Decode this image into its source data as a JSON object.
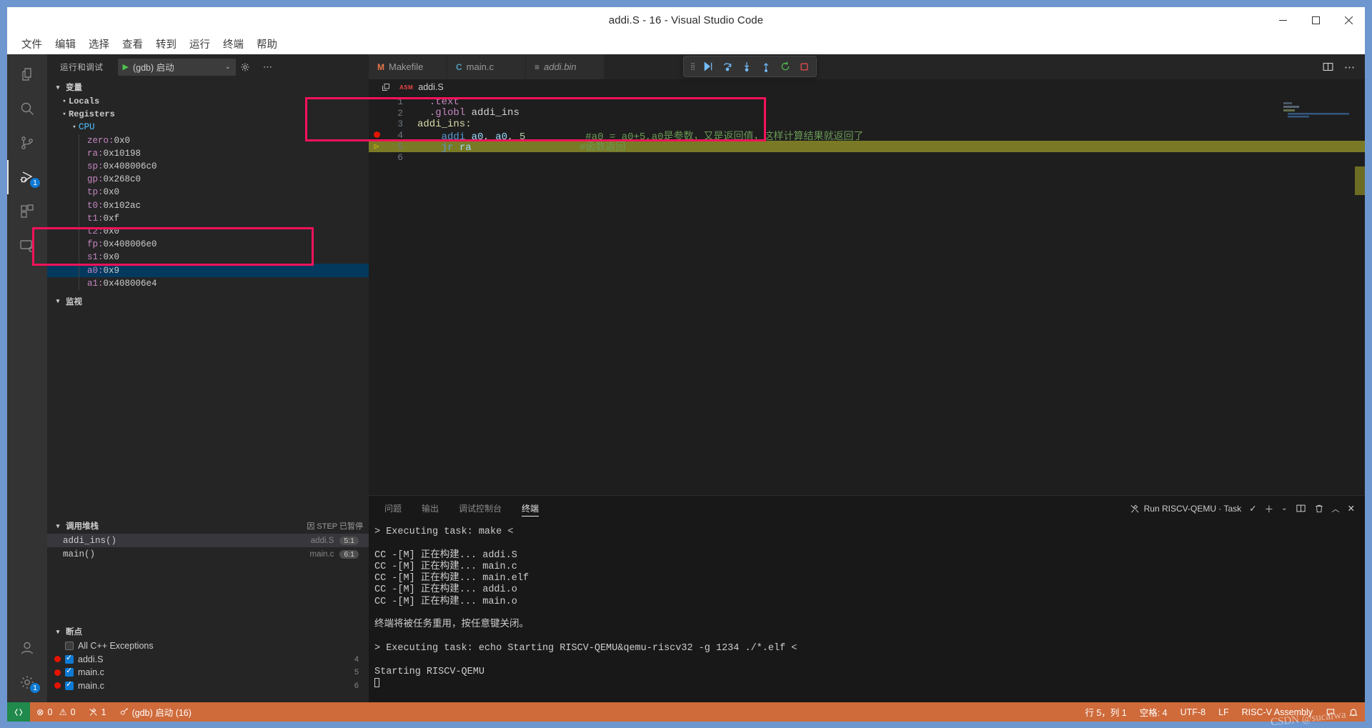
{
  "window": {
    "title": "addi.S - 16 - Visual Studio Code",
    "minimize": "–",
    "maximize": "▢",
    "close": "✕"
  },
  "menubar": {
    "items": [
      {
        "label": "文件"
      },
      {
        "label": "编辑"
      },
      {
        "label": "选择"
      },
      {
        "label": "查看"
      },
      {
        "label": "转到"
      },
      {
        "label": "运行"
      },
      {
        "label": "终端"
      },
      {
        "label": "帮助"
      }
    ]
  },
  "activitybar": {
    "items": [
      {
        "name": "explorer",
        "icon": "files-icon"
      },
      {
        "name": "search",
        "icon": "search-icon"
      },
      {
        "name": "source-control",
        "icon": "source-control-icon"
      },
      {
        "name": "run-and-debug",
        "icon": "run-debug-icon",
        "badge": "1",
        "active": true
      },
      {
        "name": "extensions",
        "icon": "extensions-icon"
      },
      {
        "name": "remote-explorer",
        "icon": "remote-explorer-icon"
      }
    ],
    "bottom": [
      {
        "name": "accounts",
        "icon": "account-icon"
      },
      {
        "name": "settings",
        "icon": "gear-icon",
        "badge": "1"
      }
    ]
  },
  "sidebar": {
    "title": "运行和调试",
    "launch_config": "(gdb) 启动",
    "gear_icon": "gear-icon",
    "more_icon": "ellipsis-icon",
    "variables": {
      "header": "变量",
      "groups": [
        {
          "label": "Locals",
          "indent": 1,
          "twisty": "▾",
          "kind": "group"
        },
        {
          "label": "Registers",
          "indent": 1,
          "twisty": "▾",
          "kind": "group"
        },
        {
          "label": "CPU",
          "indent": 2,
          "twisty": "▾",
          "kind": "cpu"
        }
      ],
      "registers": [
        {
          "name": "zero",
          "value": "0x0",
          "selected": false
        },
        {
          "name": "ra",
          "value": "0x10198",
          "selected": false
        },
        {
          "name": "sp",
          "value": "0x408006c0",
          "selected": false
        },
        {
          "name": "gp",
          "value": "0x268c0",
          "selected": false
        },
        {
          "name": "tp",
          "value": "0x0",
          "selected": false
        },
        {
          "name": "t0",
          "value": "0x102ac",
          "selected": false
        },
        {
          "name": "t1",
          "value": "0xf",
          "selected": false
        },
        {
          "name": "t2",
          "value": "0x0",
          "selected": false
        },
        {
          "name": "fp",
          "value": "0x408006e0",
          "selected": false
        },
        {
          "name": "s1",
          "value": "0x0",
          "selected": false
        },
        {
          "name": "a0",
          "value": "0x9",
          "selected": true
        },
        {
          "name": "a1",
          "value": "0x408006e4",
          "selected": false
        }
      ]
    },
    "watch": {
      "header": "监视"
    },
    "callstack": {
      "header": "调用堆栈",
      "hint": "因 STEP 已暂停",
      "frames": [
        {
          "fn": "addi_ins()",
          "file": "addi.S",
          "pos": "5:1",
          "selected": true
        },
        {
          "fn": "main()",
          "file": "main.c",
          "pos": "6:1",
          "selected": false
        }
      ]
    },
    "breakpoints": {
      "header": "断点",
      "items": [
        {
          "label": "All C++ Exceptions",
          "checked": false,
          "dot": false,
          "num": ""
        },
        {
          "label": "addi.S",
          "checked": true,
          "dot": true,
          "num": "4"
        },
        {
          "label": "main.c",
          "checked": true,
          "dot": true,
          "num": "5"
        },
        {
          "label": "main.c",
          "checked": true,
          "dot": true,
          "num": "6"
        }
      ]
    }
  },
  "editor": {
    "tabs": [
      {
        "label": "Makefile",
        "icon": "M",
        "icon_color": "#e8774b",
        "italic": false,
        "active": false
      },
      {
        "label": "main.c",
        "icon": "C",
        "icon_color": "#519aba",
        "italic": false,
        "active": false
      },
      {
        "label": "addi.bin",
        "icon": "≡",
        "icon_color": "#cccccc",
        "italic": true,
        "active": false
      }
    ],
    "actions": [
      {
        "name": "split-editor-icon",
        "glyph": "▯▯"
      },
      {
        "name": "editor-more-icon",
        "glyph": "⋯"
      }
    ],
    "breadcrumb": {
      "badge": "ASM",
      "label": "addi.S",
      "fold_icon": "collapse-all-icon"
    },
    "debug_toolbar": [
      {
        "name": "grip-handle",
        "glyph": "⋮⋮"
      },
      {
        "name": "continue-button",
        "glyph": "▶|"
      },
      {
        "name": "step-over-button",
        "glyph": "↷"
      },
      {
        "name": "step-into-button",
        "glyph": "↓"
      },
      {
        "name": "step-out-button",
        "glyph": "↑"
      },
      {
        "name": "restart-button",
        "glyph": "↺"
      },
      {
        "name": "stop-button",
        "glyph": "□"
      }
    ],
    "lines": [
      {
        "n": "1",
        "mark": "",
        "tokens": [
          {
            "t": "  ",
            "c": "plain"
          },
          {
            "t": ".text",
            "c": "dir"
          }
        ],
        "hl": false
      },
      {
        "n": "2",
        "mark": "",
        "tokens": [
          {
            "t": "  ",
            "c": "plain"
          },
          {
            "t": ".globl",
            "c": "dir"
          },
          {
            "t": " addi_ins",
            "c": "plain"
          }
        ],
        "hl": false
      },
      {
        "n": "3",
        "mark": "",
        "tokens": [
          {
            "t": "addi_ins:",
            "c": "lbl"
          }
        ],
        "hl": false
      },
      {
        "n": "4",
        "mark": "breakpoint",
        "tokens": [
          {
            "t": "    ",
            "c": "plain"
          },
          {
            "t": "addi",
            "c": "ins"
          },
          {
            "t": " ",
            "c": "plain"
          },
          {
            "t": "a0",
            "c": "reg"
          },
          {
            "t": ", ",
            "c": "plain"
          },
          {
            "t": "a0",
            "c": "reg"
          },
          {
            "t": ", ",
            "c": "plain"
          },
          {
            "t": "5",
            "c": "num"
          },
          {
            "t": "          ",
            "c": "plain"
          },
          {
            "t": "#a0 = a0+5,a0是参数，又是返回值，这样计算结果就返回了",
            "c": "cmt"
          }
        ],
        "hl": false
      },
      {
        "n": "5",
        "mark": "current",
        "tokens": [
          {
            "t": "    ",
            "c": "plain"
          },
          {
            "t": "jr",
            "c": "ins"
          },
          {
            "t": " ",
            "c": "plain"
          },
          {
            "t": "ra",
            "c": "reg"
          },
          {
            "t": "                  ",
            "c": "plain"
          },
          {
            "t": "#函数返回",
            "c": "cmt"
          }
        ],
        "hl": true
      },
      {
        "n": "6",
        "mark": "",
        "tokens": [],
        "hl": false
      }
    ]
  },
  "panel": {
    "tabs": [
      {
        "label": "问题",
        "active": false
      },
      {
        "label": "输出",
        "active": false
      },
      {
        "label": "调试控制台",
        "active": false
      },
      {
        "label": "终端",
        "active": true
      }
    ],
    "terminal_name": "Run RISCV-QEMU · Task",
    "terminal_icon": "tools-icon",
    "actions": [
      {
        "name": "task-check-icon",
        "glyph": "✓"
      },
      {
        "name": "new-terminal-icon",
        "glyph": "＋"
      },
      {
        "name": "terminal-dropdown-icon",
        "glyph": "⌄"
      },
      {
        "name": "split-terminal-icon",
        "glyph": "▯▯"
      },
      {
        "name": "kill-terminal-icon",
        "glyph": "🗑"
      },
      {
        "name": "maximize-panel-icon",
        "glyph": "︿"
      },
      {
        "name": "close-panel-icon",
        "glyph": "✕"
      }
    ],
    "terminal_lines": [
      "> Executing task: make <",
      "",
      "CC -[M] 正在构建... addi.S",
      "CC -[M] 正在构建... main.c",
      "CC -[M] 正在构建... main.elf",
      "CC -[M] 正在构建... addi.o",
      "CC -[M] 正在构建... main.o",
      "",
      "终端将被任务重用，按任意键关闭。",
      "",
      "> Executing task: echo Starting RISCV-QEMU&qemu-riscv32 -g 1234 ./*.elf <",
      "",
      "Starting RISCV-QEMU"
    ]
  },
  "statusbar": {
    "remote_icon": "remote-icon",
    "left": [
      {
        "name": "problems",
        "glyph": "⊗",
        "text": "0",
        "glyph2": "△",
        "text2": "0"
      },
      {
        "name": "tasks",
        "glyph": "🛠",
        "text": "1"
      },
      {
        "name": "debug-session",
        "glyph": "⚲",
        "text": "(gdb) 启动 (16)"
      }
    ],
    "right": [
      {
        "name": "cursor-position",
        "text": "行 5，列 1"
      },
      {
        "name": "indentation",
        "text": "空格: 4"
      },
      {
        "name": "encoding",
        "text": "UTF-8"
      },
      {
        "name": "eol",
        "text": "LF"
      },
      {
        "name": "language-mode",
        "text": "RISC-V Assembly"
      },
      {
        "name": "notifications",
        "text": ""
      }
    ]
  },
  "watermark": "CSDN @sucaiwa",
  "colors": {
    "accent": "#0e7ad4",
    "statusbar": "#cf6a3a",
    "annotation": "#f5125a",
    "highlight_line": "#7a7a26",
    "selection": "#04395e"
  }
}
